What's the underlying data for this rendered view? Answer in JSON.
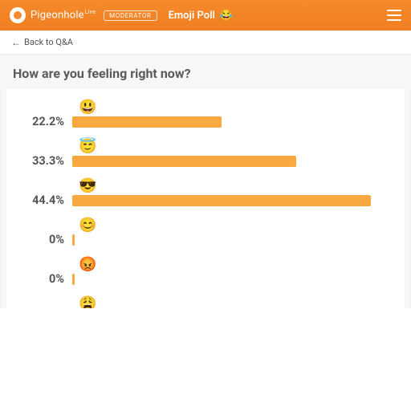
{
  "header": {
    "brand": "Pigeonhole",
    "brand_suffix": "Live",
    "badge": "MODERATOR",
    "title": "Emoji Poll",
    "title_emoji": "😂"
  },
  "nav": {
    "back_label": "Back to Q&A"
  },
  "question": "How are you feeling right now?",
  "chart_data": {
    "type": "bar",
    "title": "How are you feeling right now?",
    "xlabel": "",
    "ylabel": "",
    "ylim": [
      0,
      100
    ],
    "categories": [
      "😃",
      "😇",
      "😎",
      "😊",
      "😡",
      "😩"
    ],
    "values": [
      22.2,
      33.3,
      44.4,
      0,
      0,
      null
    ],
    "display_percent": [
      "22.2%",
      "33.3%",
      "44.4%",
      "0%",
      "0%",
      ""
    ]
  },
  "colors": {
    "brand": "#f58a2d",
    "bar": "#f7a93f"
  }
}
